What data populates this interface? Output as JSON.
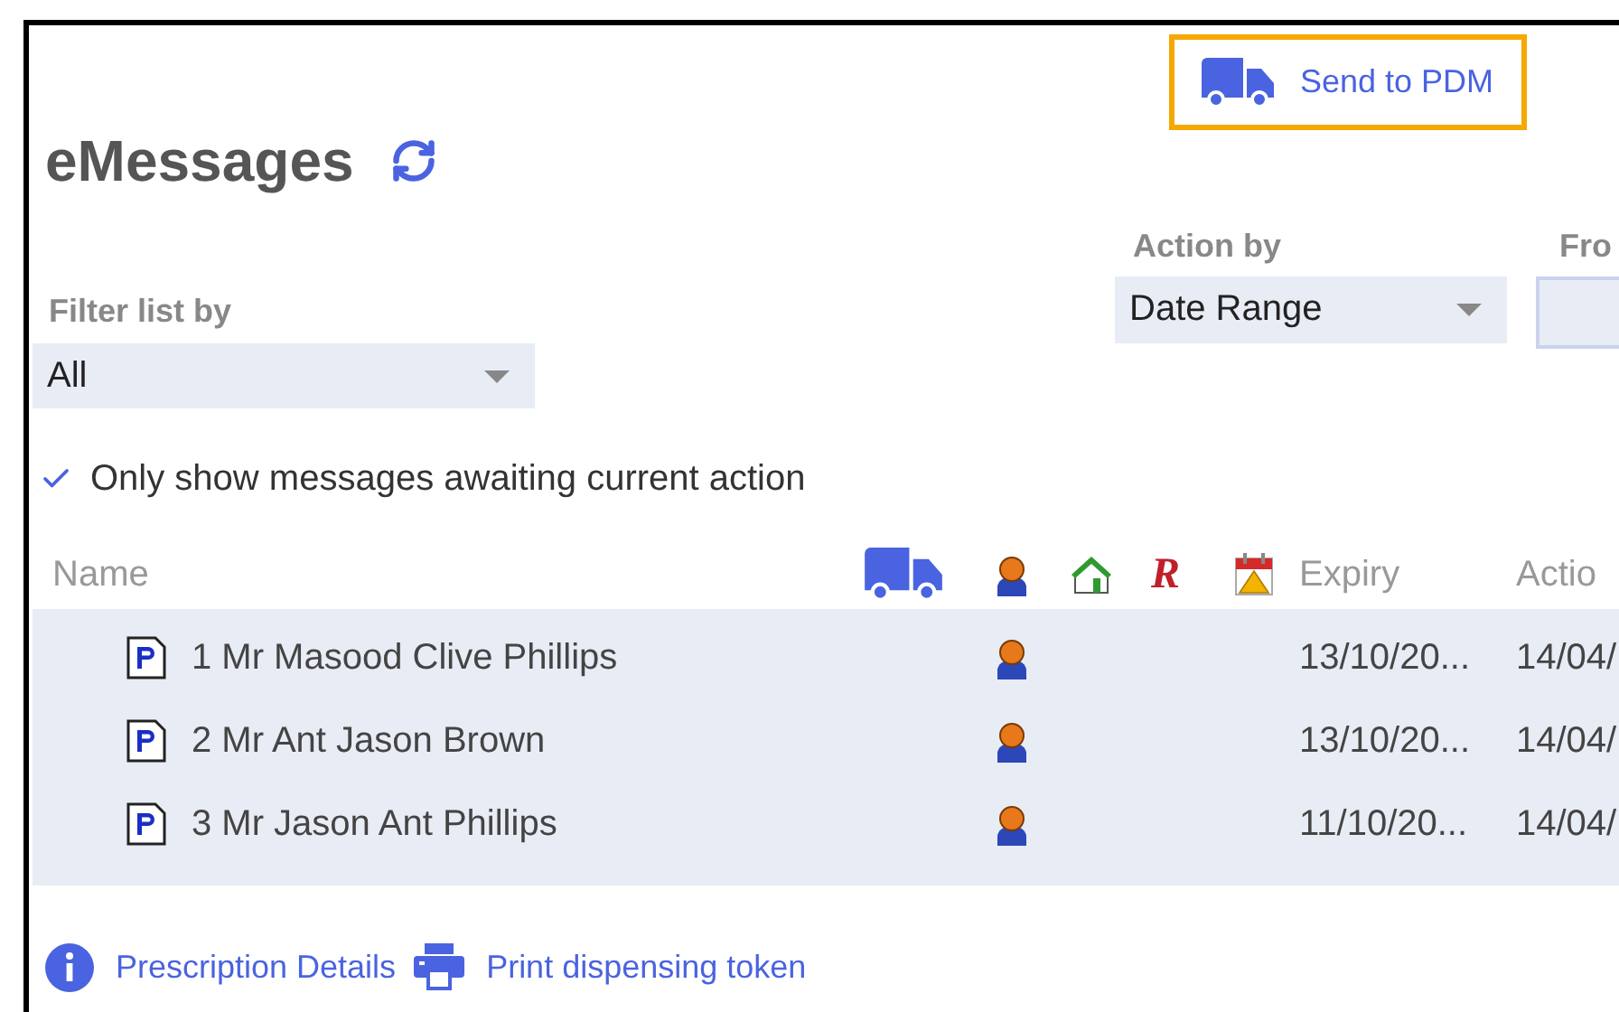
{
  "header": {
    "send_button": "Send to PDM",
    "title": "eMessages"
  },
  "filter": {
    "label": "Filter list by",
    "value": "All"
  },
  "action_by": {
    "label": "Action by",
    "value": "Date Range"
  },
  "from": {
    "label": "Fro"
  },
  "only_awaiting": {
    "label": "Only show messages awaiting current action",
    "checked": true
  },
  "table": {
    "columns": [
      {
        "kind": "text",
        "label": "Name"
      },
      {
        "kind": "truck"
      },
      {
        "kind": "person"
      },
      {
        "kind": "home"
      },
      {
        "kind": "glyph",
        "label": "R"
      },
      {
        "kind": "calendar"
      },
      {
        "kind": "text",
        "label": "Expiry"
      },
      {
        "kind": "text",
        "label": "Actio"
      }
    ],
    "rows": [
      {
        "name": "1 Mr Masood Clive Phillips",
        "person": true,
        "expiry": "13/10/20...",
        "action": "14/04/"
      },
      {
        "name": "2 Mr Ant Jason Brown",
        "person": true,
        "expiry": "13/10/20...",
        "action": "14/04/"
      },
      {
        "name": "3 Mr Jason Ant Phillips",
        "person": true,
        "expiry": "11/10/20...",
        "action": "14/04/"
      }
    ]
  },
  "links": [
    {
      "kind": "info",
      "label": "Prescription Details"
    },
    {
      "kind": "print",
      "label": "Print dispensing token"
    }
  ]
}
